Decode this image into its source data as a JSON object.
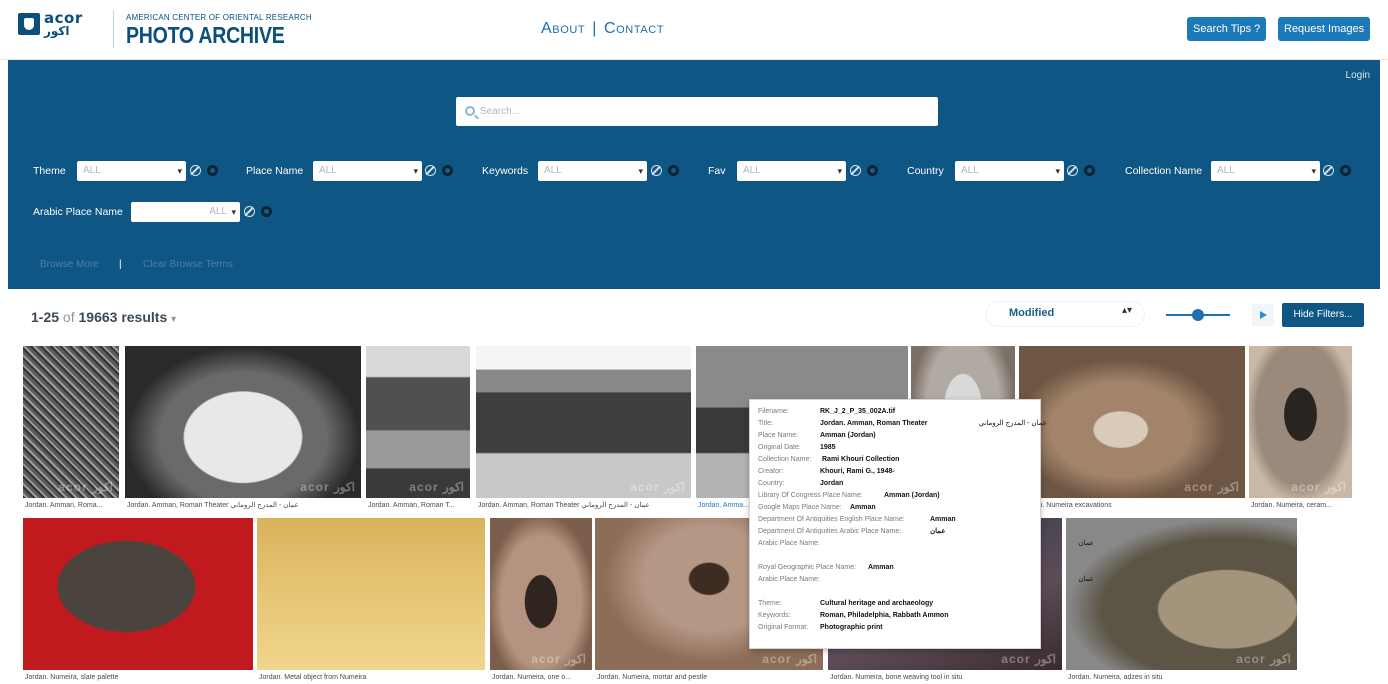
{
  "header": {
    "logo": {
      "en": "acor",
      "ar": "اكور"
    },
    "org_name": "AMERICAN CENTER OF ORIENTAL RESEARCH",
    "title": "PHOTO ARCHIVE",
    "nav": [
      "About",
      "Contact"
    ],
    "nav_sep": "|",
    "search_tips_button": "Search Tips ?",
    "request_images_button": "Request Images"
  },
  "filters": {
    "login": "Login",
    "search_placeholder": "Search...",
    "fields": [
      {
        "label": "Theme",
        "value": "ALL"
      },
      {
        "label": "Place Name",
        "value": "ALL"
      },
      {
        "label": "Keywords",
        "value": "ALL"
      },
      {
        "label": "Fav",
        "value": "ALL"
      },
      {
        "label": "Country",
        "value": "ALL"
      },
      {
        "label": "Collection Name",
        "value": "ALL"
      },
      {
        "label": "Arabic Place Name",
        "value": "ALL"
      }
    ],
    "browse_more": "Browse More",
    "browse_sep": "|",
    "clear_browse": "Clear Browse Terms"
  },
  "results": {
    "range": "1-25",
    "of": "of",
    "count": "19663 results",
    "caret": "▾",
    "sort_value": "Modified",
    "sort_arrows": "▴▾",
    "hide_filters": "Hide Filters..."
  },
  "watermark": "acor اكور",
  "grid": [
    {
      "caption": "Jordan. Amman, Roma...",
      "style": "bw1",
      "link": false
    },
    {
      "caption": "Jordan. Amman, Roman Theater عمان - المدرج الروماني",
      "style": "bw2",
      "link": false
    },
    {
      "caption": "Jordan. Amman, Roman T...",
      "style": "bw3",
      "link": false
    },
    {
      "caption": "Jordan. Amman, Roman Theater عمان - المدرج الروماني",
      "style": "bw4",
      "link": false
    },
    {
      "caption": "Jordan. Amma...",
      "style": "bw5",
      "link": true
    },
    {
      "caption": "",
      "style": "stone",
      "link": false
    },
    {
      "caption": "Jordan. Numeira excavations",
      "style": "dig",
      "link": false
    },
    {
      "caption": "Jordan. Numeira, ceram...",
      "style": "jar",
      "link": false
    },
    {
      "caption": "Jordan. Numeira, slate palette",
      "style": "red",
      "link": false
    },
    {
      "caption": "Jordan. Metal object from Numeira",
      "style": "metal",
      "link": false
    },
    {
      "caption": "Jordan. Numeira, one o...",
      "style": "pit",
      "link": false
    },
    {
      "caption": "Jordan. Numeira, mortar and pestle",
      "style": "mortar",
      "link": false
    },
    {
      "caption": "Jordan. Numeira, bone weaving tool in situ",
      "style": "dark",
      "link": false
    },
    {
      "caption": "Jordan. Numeira, adzes in situ",
      "style": "adze",
      "link": false
    }
  ],
  "tooltip": {
    "rows": [
      {
        "k": "Filename:",
        "v": "RK_J_2_P_35_002A.tif",
        "ar": ""
      },
      {
        "k": "Title:",
        "v": "Jordan. Amman, Roman Theater",
        "ar": "عمان - المدرج الروماني"
      },
      {
        "k": "Place Name:",
        "v": "Amman (Jordan)",
        "ar": ""
      },
      {
        "k": "Original Date:",
        "v": "1985",
        "ar": ""
      },
      {
        "k": "Collection Name:",
        "v": "Rami Khouri Collection",
        "ar": ""
      },
      {
        "k": "Creator:",
        "v": "Khouri, Rami G., 1948-",
        "ar": ""
      },
      {
        "k": "Country:",
        "v": "Jordan",
        "ar": ""
      },
      {
        "k": "Library Of Congress Place Name:",
        "v": "Amman (Jordan)",
        "ar": ""
      },
      {
        "k": "Google Maps Place Name:",
        "v": "Amman",
        "ar": ""
      },
      {
        "k": "Department Of Antiquities English Place Name:",
        "v": "Amman",
        "ar": ""
      },
      {
        "k": "Department Of Antiquities Arabic Place Name:",
        "v": "عمان",
        "ar": ""
      },
      {
        "k": "Arabic Place Name:",
        "v": "",
        "ar": "عمان"
      },
      {
        "k": "",
        "v": "",
        "ar": ""
      },
      {
        "k": "Royal Geographic Place Name:",
        "v": "Amman",
        "ar": ""
      },
      {
        "k": "Arabic Place Name:",
        "v": "",
        "ar": "عمان"
      },
      {
        "k": "",
        "v": "",
        "ar": ""
      },
      {
        "k": "Theme:",
        "v": "Cultural heritage and archaeology",
        "ar": ""
      },
      {
        "k": "Keywords:",
        "v": "Roman, Philadelphia, Rabbath Ammon",
        "ar": ""
      },
      {
        "k": "Original Format:",
        "v": "Photographic print",
        "ar": ""
      }
    ]
  }
}
